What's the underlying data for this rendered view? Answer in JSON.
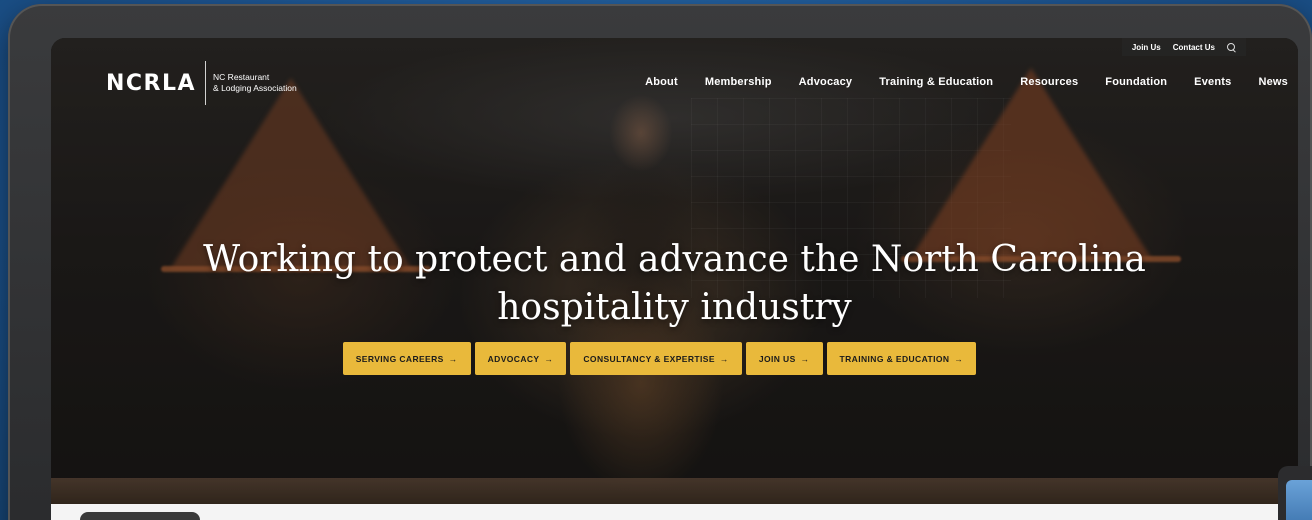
{
  "brand": {
    "mark": "NCRLA",
    "subtitle_line1": "NC Restaurant",
    "subtitle_line2": "& Lodging Association"
  },
  "utility_nav": [
    {
      "label": "Join Us"
    },
    {
      "label": "Contact Us"
    }
  ],
  "main_nav": [
    {
      "label": "About"
    },
    {
      "label": "Membership"
    },
    {
      "label": "Advocacy"
    },
    {
      "label": "Training & Education"
    },
    {
      "label": "Resources"
    },
    {
      "label": "Foundation"
    },
    {
      "label": "Events"
    },
    {
      "label": "News"
    }
  ],
  "hero": {
    "headline_line1": "Working to protect and advance the North Carolina",
    "headline_line2": "hospitality industry"
  },
  "ctas": [
    {
      "label": "SERVING CAREERS",
      "arrow": "→"
    },
    {
      "label": "ADVOCACY",
      "arrow": "→"
    },
    {
      "label": "CONSULTANCY & EXPERTISE",
      "arrow": "→"
    },
    {
      "label": "JOIN US",
      "arrow": "→"
    },
    {
      "label": "TRAINING & EDUCATION",
      "arrow": "→"
    }
  ],
  "colors": {
    "backdrop": "#1f5d9a",
    "cta_background": "#e9b93b",
    "cta_text": "#1b1b1b"
  }
}
